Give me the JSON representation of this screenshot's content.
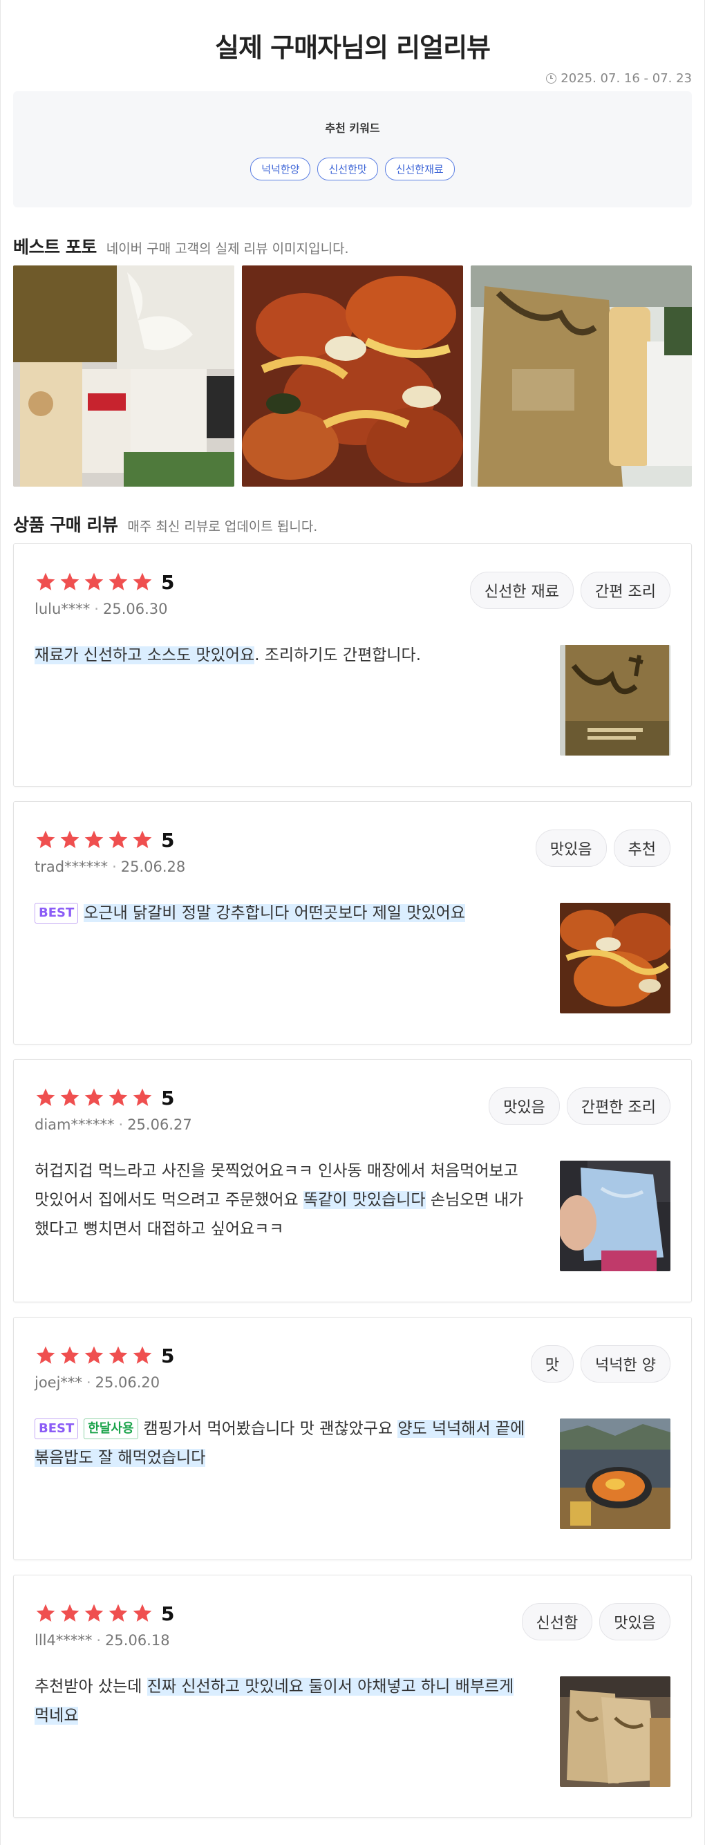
{
  "header": {
    "title": "실제 구매자님의 리얼리뷰",
    "period": "2025. 07. 16 - 07. 23"
  },
  "keywords": {
    "title": "추천 키워드",
    "items": [
      "넉넉한양",
      "신선한맛",
      "신선한재료"
    ]
  },
  "best_photo": {
    "title": "베스트 포토",
    "desc": "네이버 구매 고객의 실제 리뷰 이미지입니다."
  },
  "reviews_section": {
    "title": "상품 구매 리뷰",
    "desc": "매주 최신 리뷰로 업데이트 됩니다."
  },
  "colors": {
    "star": "#ef4f4f",
    "keyword_border": "#5b7fe3",
    "highlight": "#dbeeff",
    "best_badge": "#8b5cf6",
    "month_badge": "#1aa34a"
  },
  "reviews": [
    {
      "score": "5",
      "user": "lulu****",
      "date": "25.06.30",
      "tags": [
        "신선한 재료",
        "간편 조리"
      ],
      "badges": [],
      "segments": [
        {
          "text": "재료가 신선하고 소스도 맛있어요",
          "hl": true
        },
        {
          "text": ". 조리하기도 간편합니다.",
          "hl": false
        }
      ]
    },
    {
      "score": "5",
      "user": "trad******",
      "date": "25.06.28",
      "tags": [
        "맛있음",
        "추천"
      ],
      "badges": [
        "BEST"
      ],
      "segments": [
        {
          "text": "오근내 닭갈비 정말 강추합니다 어떤곳보다 제일 맛있어요",
          "hl": true
        }
      ]
    },
    {
      "score": "5",
      "user": "diam******",
      "date": "25.06.27",
      "tags": [
        "맛있음",
        "간편한 조리"
      ],
      "badges": [],
      "segments": [
        {
          "text": "허겁지겁 먹느라고 사진을 못찍었어요ㅋㅋ 인사동 매장에서 처음먹어보고 맛있어서 집에서도 먹으려고 주문했어요 ",
          "hl": false
        },
        {
          "text": "똑같이 맛있습니다",
          "hl": true
        },
        {
          "text": " 손님오면 내가했다고 뻥치면서 대접하고 싶어요ㅋㅋ",
          "hl": false
        }
      ]
    },
    {
      "score": "5",
      "user": "joej***",
      "date": "25.06.20",
      "tags": [
        "맛",
        "넉넉한 양"
      ],
      "badges": [
        "BEST",
        "한달사용"
      ],
      "segments": [
        {
          "text": "캠핑가서 먹어봤습니다 맛 괜찮았구요 ",
          "hl": false
        },
        {
          "text": "양도 넉넉해서 끝에 볶음밥도 잘 해먹었습니다",
          "hl": true
        }
      ]
    },
    {
      "score": "5",
      "user": "lll4*****",
      "date": "25.06.18",
      "tags": [
        "신선함",
        "맛있음"
      ],
      "badges": [],
      "segments": [
        {
          "text": "추천받아 샀는데 ",
          "hl": false
        },
        {
          "text": "진짜 신선하고 맛있네요 둘이서 야채넣고 하니 배부르게 먹네요",
          "hl": true
        }
      ]
    }
  ]
}
